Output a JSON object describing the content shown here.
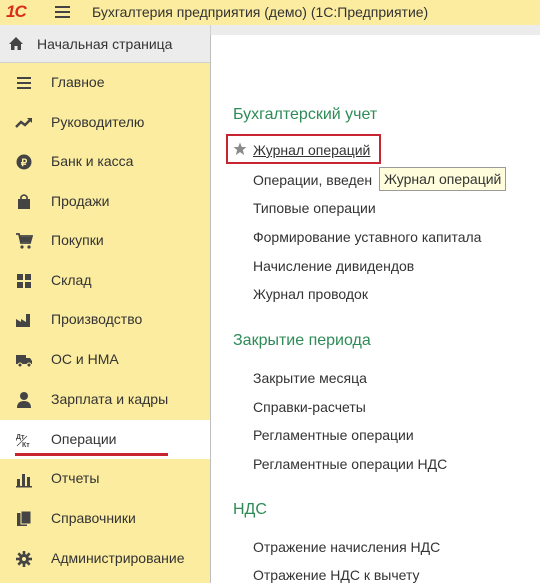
{
  "titlebar": {
    "logo": "1С",
    "title": "Бухгалтерия предприятия (демо)  (1С:Предприятие)"
  },
  "home_tab": {
    "label": "Начальная страница"
  },
  "sidebar": {
    "items": [
      {
        "label": "Главное",
        "icon": "menu-lines-icon"
      },
      {
        "label": "Руководителю",
        "icon": "trend-icon"
      },
      {
        "label": "Банк и касса",
        "icon": "coin-icon"
      },
      {
        "label": "Продажи",
        "icon": "shopping-bag-icon"
      },
      {
        "label": "Покупки",
        "icon": "cart-icon"
      },
      {
        "label": "Склад",
        "icon": "warehouse-icon"
      },
      {
        "label": "Производство",
        "icon": "factory-icon"
      },
      {
        "label": "ОС и НМА",
        "icon": "truck-icon"
      },
      {
        "label": "Зарплата и кадры",
        "icon": "person-icon"
      },
      {
        "label": "Операции",
        "icon": "debit-credit-icon",
        "active": true
      },
      {
        "label": "Отчеты",
        "icon": "bar-chart-icon"
      },
      {
        "label": "Справочники",
        "icon": "books-icon"
      },
      {
        "label": "Администрирование",
        "icon": "gear-icon"
      }
    ]
  },
  "content": {
    "sections": [
      {
        "title": "Бухгалтерский учет",
        "links": [
          "Журнал операций",
          "Операции, введен",
          "Типовые операции",
          "Формирование уставного капитала",
          "Начисление дивидендов",
          "Журнал проводок"
        ]
      },
      {
        "title": "Закрытие периода",
        "links": [
          "Закрытие месяца",
          "Справки-расчеты",
          "Регламентные операции",
          "Регламентные операции НДС"
        ]
      },
      {
        "title": "НДС",
        "links": [
          "Отражение начисления НДС",
          "Отражение НДС к вычету"
        ]
      }
    ],
    "tooltip": "Журнал операций"
  },
  "colors": {
    "sidebar_bg": "#fbeca0",
    "section_title": "#2e8b57",
    "highlight_red": "#c8242f",
    "logo_red": "#d92d1b"
  }
}
